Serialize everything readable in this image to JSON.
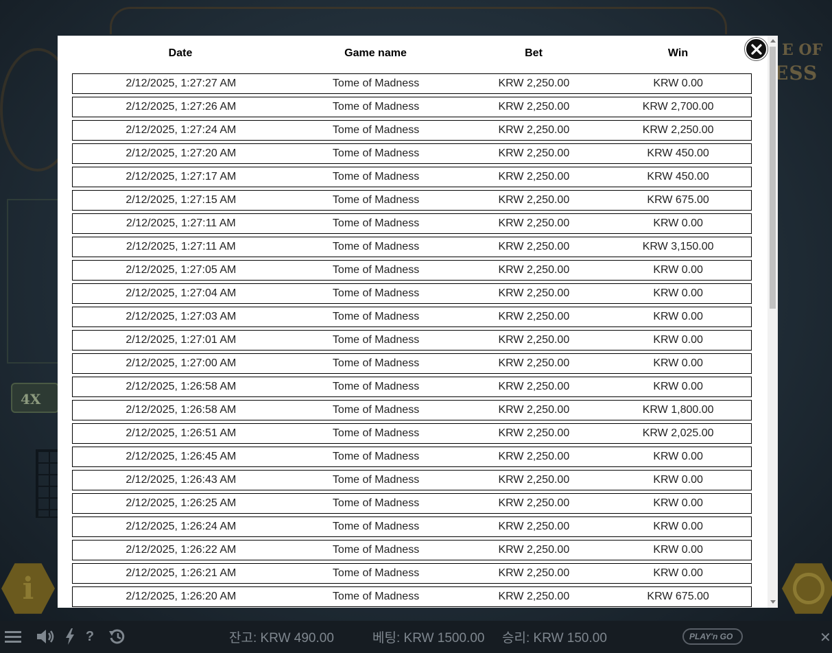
{
  "history": {
    "headers": {
      "date": "Date",
      "game_name": "Game name",
      "bet": "Bet",
      "win": "Win"
    },
    "rows": [
      {
        "date": "2/12/2025, 1:27:27 AM",
        "game": "Tome of Madness",
        "bet": "KRW 2,250.00",
        "win": "KRW 0.00"
      },
      {
        "date": "2/12/2025, 1:27:26 AM",
        "game": "Tome of Madness",
        "bet": "KRW 2,250.00",
        "win": "KRW 2,700.00"
      },
      {
        "date": "2/12/2025, 1:27:24 AM",
        "game": "Tome of Madness",
        "bet": "KRW 2,250.00",
        "win": "KRW 2,250.00"
      },
      {
        "date": "2/12/2025, 1:27:20 AM",
        "game": "Tome of Madness",
        "bet": "KRW 2,250.00",
        "win": "KRW 450.00"
      },
      {
        "date": "2/12/2025, 1:27:17 AM",
        "game": "Tome of Madness",
        "bet": "KRW 2,250.00",
        "win": "KRW 450.00"
      },
      {
        "date": "2/12/2025, 1:27:15 AM",
        "game": "Tome of Madness",
        "bet": "KRW 2,250.00",
        "win": "KRW 675.00"
      },
      {
        "date": "2/12/2025, 1:27:11 AM",
        "game": "Tome of Madness",
        "bet": "KRW 2,250.00",
        "win": "KRW 0.00"
      },
      {
        "date": "2/12/2025, 1:27:11 AM",
        "game": "Tome of Madness",
        "bet": "KRW 2,250.00",
        "win": "KRW 3,150.00"
      },
      {
        "date": "2/12/2025, 1:27:05 AM",
        "game": "Tome of Madness",
        "bet": "KRW 2,250.00",
        "win": "KRW 0.00"
      },
      {
        "date": "2/12/2025, 1:27:04 AM",
        "game": "Tome of Madness",
        "bet": "KRW 2,250.00",
        "win": "KRW 0.00"
      },
      {
        "date": "2/12/2025, 1:27:03 AM",
        "game": "Tome of Madness",
        "bet": "KRW 2,250.00",
        "win": "KRW 0.00"
      },
      {
        "date": "2/12/2025, 1:27:01 AM",
        "game": "Tome of Madness",
        "bet": "KRW 2,250.00",
        "win": "KRW 0.00"
      },
      {
        "date": "2/12/2025, 1:27:00 AM",
        "game": "Tome of Madness",
        "bet": "KRW 2,250.00",
        "win": "KRW 0.00"
      },
      {
        "date": "2/12/2025, 1:26:58 AM",
        "game": "Tome of Madness",
        "bet": "KRW 2,250.00",
        "win": "KRW 0.00"
      },
      {
        "date": "2/12/2025, 1:26:58 AM",
        "game": "Tome of Madness",
        "bet": "KRW 2,250.00",
        "win": "KRW 1,800.00"
      },
      {
        "date": "2/12/2025, 1:26:51 AM",
        "game": "Tome of Madness",
        "bet": "KRW 2,250.00",
        "win": "KRW 2,025.00"
      },
      {
        "date": "2/12/2025, 1:26:45 AM",
        "game": "Tome of Madness",
        "bet": "KRW 2,250.00",
        "win": "KRW 0.00"
      },
      {
        "date": "2/12/2025, 1:26:43 AM",
        "game": "Tome of Madness",
        "bet": "KRW 2,250.00",
        "win": "KRW 0.00"
      },
      {
        "date": "2/12/2025, 1:26:25 AM",
        "game": "Tome of Madness",
        "bet": "KRW 2,250.00",
        "win": "KRW 0.00"
      },
      {
        "date": "2/12/2025, 1:26:24 AM",
        "game": "Tome of Madness",
        "bet": "KRW 2,250.00",
        "win": "KRW 0.00"
      },
      {
        "date": "2/12/2025, 1:26:22 AM",
        "game": "Tome of Madness",
        "bet": "KRW 2,250.00",
        "win": "KRW 0.00"
      },
      {
        "date": "2/12/2025, 1:26:21 AM",
        "game": "Tome of Madness",
        "bet": "KRW 2,250.00",
        "win": "KRW 0.00"
      },
      {
        "date": "2/12/2025, 1:26:20 AM",
        "game": "Tome of Madness",
        "bet": "KRW 2,250.00",
        "win": "KRW 675.00"
      }
    ]
  },
  "modal": {
    "close_icon": "close-icon"
  },
  "game": {
    "logo_top": "E OF",
    "logo_bottom": "ESS",
    "multiplier": "4X",
    "info_glyph": "i"
  },
  "bottom_bar": {
    "balance": "잔고: KRW 490.00",
    "bet": "베팅: KRW 1500.00",
    "win": "승리: KRW 150.00",
    "help_glyph": "?",
    "logo": "PLAY'n GO",
    "close_glyph": "✕",
    "icons": [
      "menu-icon",
      "sound-icon",
      "turbo-icon",
      "help-icon",
      "history-icon"
    ]
  },
  "colors": {
    "modal_bg": "#ffffff",
    "row_border": "#000000",
    "close_button": "#111111",
    "bottom_bar_bg": "#161c22"
  }
}
